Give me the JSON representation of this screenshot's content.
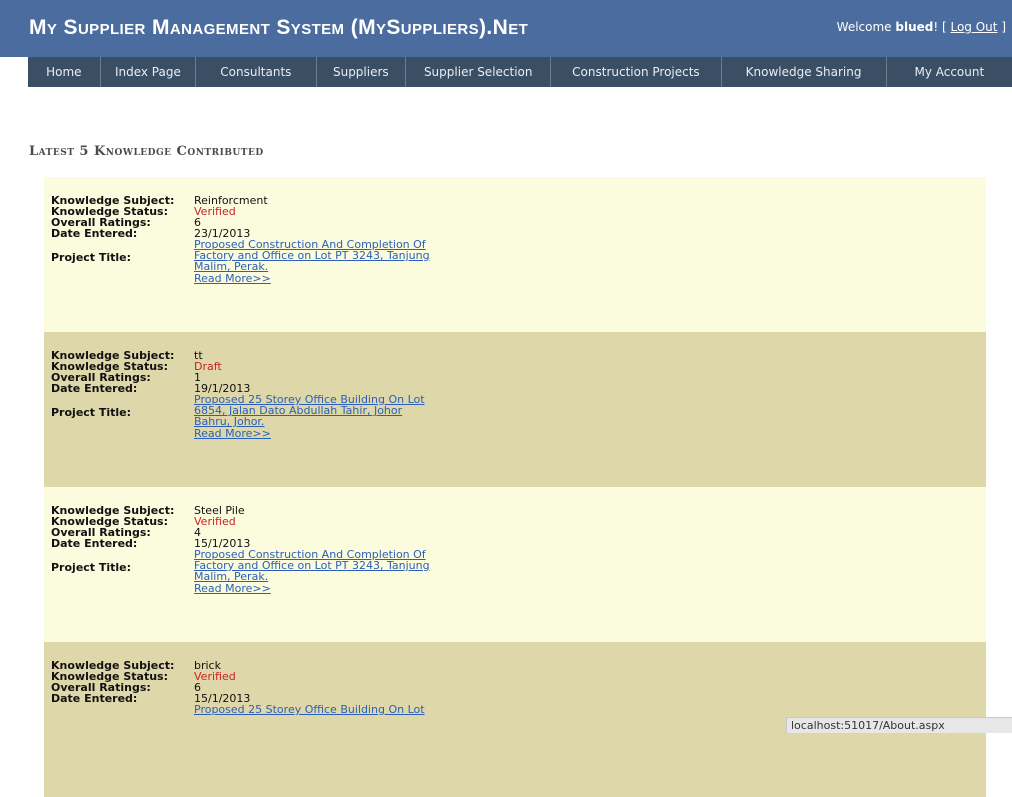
{
  "header": {
    "site_title": "My Supplier Management System (MySuppliers).Net",
    "welcome_prefix": "Welcome ",
    "username": "blued",
    "welcome_suffix": "! [ ",
    "logout_label": "Log Out",
    "logout_suffix": " ]",
    "background_color": "#4b6c9e"
  },
  "nav": {
    "items": [
      "Home",
      "Index Page",
      "Consultants",
      "Suppliers",
      "Supplier Selection",
      "Construction Projects",
      "Knowledge Sharing",
      "My Account"
    ]
  },
  "section_title": "Latest 5 Knowledge Contributed",
  "labels": {
    "subject": "Knowledge Subject:",
    "status": "Knowledge Status:",
    "ratings": "Overall Ratings:",
    "date": "Date Entered:",
    "project": "Project Title:",
    "read_more": "Read More>>"
  },
  "records": [
    {
      "subject": "Reinforcment",
      "status": "Verified",
      "ratings": "6",
      "date": "23/1/2013",
      "project_lines": [
        "Proposed Construction And Completion Of",
        "Factory and Office on Lot PT 3243, Tanjung",
        "Malim, Perak."
      ]
    },
    {
      "subject": "tt",
      "status": "Draft",
      "ratings": "1",
      "date": "19/1/2013",
      "project_lines": [
        "Proposed 25 Storey Office Building On Lot",
        "6854, Jalan Dato Abdullah Tahir, Johor",
        "Bahru, Johor."
      ]
    },
    {
      "subject": "Steel Pile",
      "status": "Verified",
      "ratings": "4",
      "date": "15/1/2013",
      "project_lines": [
        "Proposed Construction And Completion Of",
        "Factory and Office on Lot PT 3243, Tanjung",
        "Malim, Perak."
      ]
    },
    {
      "subject": "brick",
      "status": "Verified",
      "ratings": "6",
      "date": "15/1/2013",
      "project_lines": [
        "Proposed 25 Storey Office Building On Lot"
      ]
    }
  ],
  "status_bar": "localhost:51017/About.aspx"
}
